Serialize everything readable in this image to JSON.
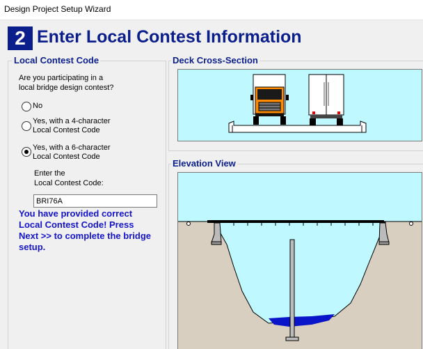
{
  "window": {
    "title": "Design Project Setup Wizard"
  },
  "header": {
    "step_number": "2",
    "title": "Enter Local Contest Information"
  },
  "contest": {
    "group_title": "Local Contest Code",
    "question_line1": "Are you participating in a",
    "question_line2": "local bridge design contest?",
    "options": [
      {
        "line1": "No",
        "line2": "",
        "checked": false
      },
      {
        "line1": "Yes, with a 4-character",
        "line2": "Local Contest Code",
        "checked": false
      },
      {
        "line1": "Yes, with a 6-character",
        "line2": "Local Contest Code",
        "checked": true
      }
    ],
    "code_label_line1": "Enter the",
    "code_label_line2": "Local Contest Code:",
    "code_value": "BRI76A",
    "message": "You have provided correct Local Contest Code! Press Next >> to complete the bridge setup."
  },
  "deck": {
    "title": "Deck Cross-Section"
  },
  "elevation": {
    "title": "Elevation View"
  },
  "colors": {
    "accent": "#0a1e8c",
    "message": "#1414c8",
    "sky": "#bff8ff",
    "ground": "#d9cfc0",
    "water": "#0a14c8",
    "truck": "#ff8a00"
  }
}
